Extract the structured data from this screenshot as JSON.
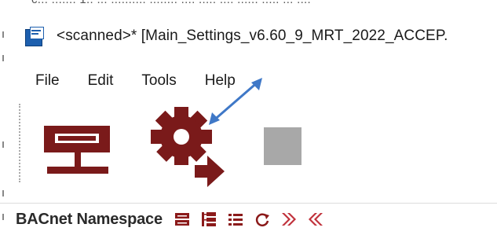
{
  "window": {
    "title": "<scanned>* [Main_Settings_v6.60_9_MRT_2022_ACCEP."
  },
  "menu": {
    "items": [
      "File",
      "Edit",
      "Tools",
      "Help"
    ]
  },
  "toolbar": {
    "buttons": [
      {
        "icon": "network-device-icon"
      },
      {
        "icon": "settings-gear-export-icon"
      },
      {
        "icon": "stop-square-icon"
      }
    ],
    "accent_color": "#7a1a1a",
    "disabled_color": "#a8a8a8"
  },
  "annotation": {
    "arrow_color": "#3f78c7"
  },
  "namespace_bar": {
    "label": "BACnet Namespace",
    "icons": [
      "collapse-icon",
      "tree-expand-icon",
      "list-icon",
      "refresh-icon",
      "next-icon",
      "previous-icon"
    ]
  }
}
